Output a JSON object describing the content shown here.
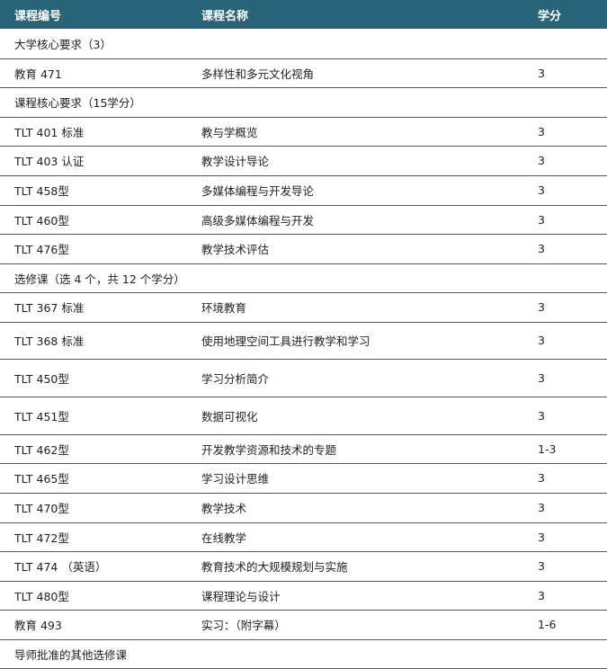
{
  "header": {
    "code": "课程编号",
    "name": "课程名称",
    "credits": "学分"
  },
  "rows": [
    {
      "type": "section",
      "text": "大学核心要求（3）"
    },
    {
      "type": "course",
      "code": "教育 471",
      "name": "多样性和多元文化视角",
      "credits": "3"
    },
    {
      "type": "section",
      "text": "课程核心要求（15学分）"
    },
    {
      "type": "course",
      "code": "TLT 401 标准",
      "name": "教与学概览",
      "credits": "3"
    },
    {
      "type": "course",
      "code": "TLT 403 认证",
      "name": "教学设计导论",
      "credits": "3"
    },
    {
      "type": "course",
      "code": "TLT 458型",
      "name": "多媒体编程与开发导论",
      "credits": "3"
    },
    {
      "type": "course",
      "code": "TLT 460型",
      "name": "高级多媒体编程与开发",
      "credits": "3"
    },
    {
      "type": "course",
      "code": "TLT 476型",
      "name": "教学技术评估",
      "credits": "3"
    },
    {
      "type": "section",
      "text": "选修课（选 4 个，共 12 个学分）"
    },
    {
      "type": "course",
      "code": "TLT 367 标准",
      "name": "环境教育",
      "credits": "3"
    },
    {
      "type": "course",
      "code": "TLT 368 标准",
      "name": "使用地理空间工具进行教学和学习",
      "credits": "3"
    },
    {
      "type": "course",
      "code": "TLT 450型",
      "name": "学习分析简介",
      "credits": "3"
    },
    {
      "type": "course",
      "code": "TLT 451型",
      "name": "数据可视化",
      "credits": "3"
    },
    {
      "type": "course",
      "code": "TLT 462型",
      "name": "开发教学资源和技术的专题",
      "credits": "1-3"
    },
    {
      "type": "course",
      "code": "TLT 465型",
      "name": "学习设计思维",
      "credits": "3"
    },
    {
      "type": "course",
      "code": "TLT 470型",
      "name": "教学技术",
      "credits": "3"
    },
    {
      "type": "course",
      "code": "TLT 472型",
      "name": "在线教学",
      "credits": "3"
    },
    {
      "type": "course",
      "code": "TLT 474 （英语）",
      "name": "教育技术的大规模规划与实施",
      "credits": "3"
    },
    {
      "type": "course",
      "code": "TLT 480型",
      "name": "课程理论与设计",
      "credits": "3"
    },
    {
      "type": "course",
      "code": "教育 493",
      "name": "实习：（附字幕）",
      "credits": "1-6"
    },
    {
      "type": "section",
      "text": "导师批准的其他选修课"
    }
  ]
}
